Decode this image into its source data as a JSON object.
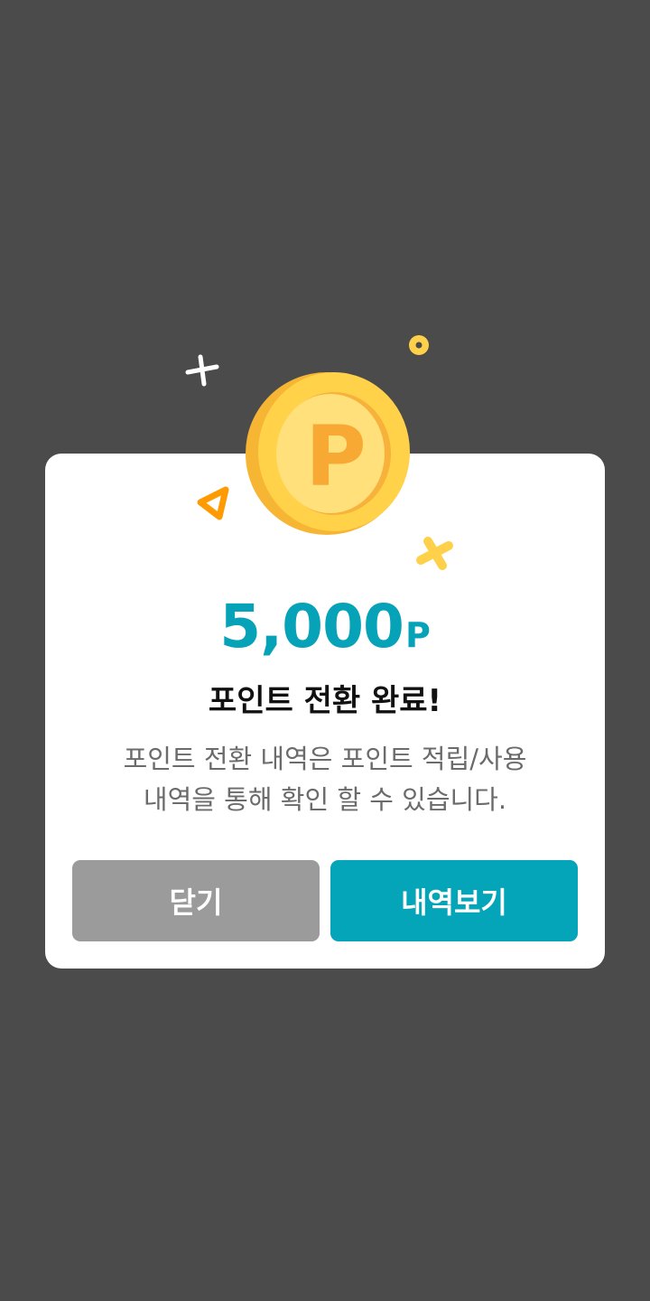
{
  "colors": {
    "background": "#4b4b4b",
    "dialog": "#ffffff",
    "accent": "#04a5b8",
    "close_button": "#9b9b9b",
    "coin": "#ffd04a",
    "coin_letter": "#f7a934"
  },
  "icons": {
    "coin": "coin-p-icon",
    "sparkles": [
      "plus-sparkle-icon",
      "circle-sparkle-icon",
      "triangle-sparkle-icon",
      "cross-sparkle-icon"
    ]
  },
  "coin": {
    "letter": "P"
  },
  "result": {
    "amount": "5,000",
    "unit": "P",
    "title": "포인트 전환 완료!",
    "description_line1": "포인트 전환 내역은 포인트 적립/사용",
    "description_line2": "내역을 통해 확인 할 수 있습니다."
  },
  "buttons": {
    "close_label": "닫기",
    "history_label": "내역보기"
  }
}
